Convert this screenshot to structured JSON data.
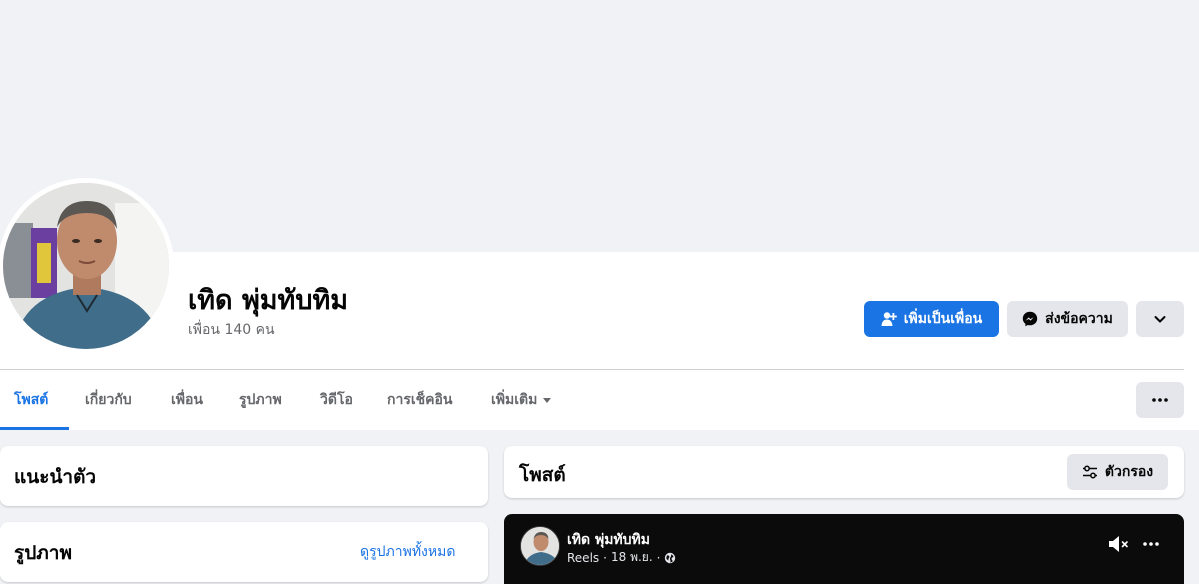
{
  "profile": {
    "name": "เทิด พุ่มทับทิม",
    "friends": "เพื่อน 140 คน"
  },
  "actions": {
    "add_friend": "เพิ่มเป็นเพื่อน",
    "message": "ส่งข้อความ"
  },
  "tabs": [
    {
      "label": "โพสต์",
      "active": true
    },
    {
      "label": "เกี่ยวกับ"
    },
    {
      "label": "เพื่อน"
    },
    {
      "label": "รูปภาพ"
    },
    {
      "label": "วิดีโอ"
    },
    {
      "label": "การเช็คอิน"
    },
    {
      "label": "เพิ่มเติม"
    }
  ],
  "intro": {
    "title": "แนะนำตัว"
  },
  "photos": {
    "title": "รูปภาพ",
    "see_all": "ดูรูปภาพทั้งหมด"
  },
  "posts": {
    "title": "โพสต์",
    "filter": "ตัวกรอง"
  },
  "reel_post": {
    "author": "เทิด พุ่มทับทิม",
    "type": "Reels",
    "date": "18 พ.ย."
  },
  "colors": {
    "accent": "#1b74e4",
    "page_bg": "#f0f2f5",
    "secondary_button": "#e4e6eb"
  }
}
